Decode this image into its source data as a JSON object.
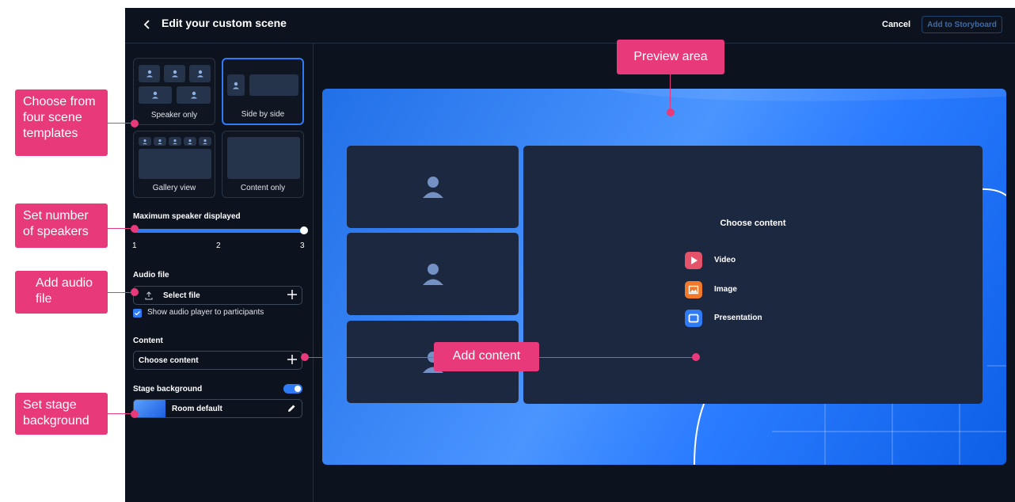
{
  "header": {
    "title": "Edit your custom scene",
    "cancel_label": "Cancel",
    "add_label": "Add to Storyboard"
  },
  "templates": [
    {
      "label": "Speaker only",
      "selected": false
    },
    {
      "label": "Side by side",
      "selected": true
    },
    {
      "label": "Gallery view",
      "selected": false
    },
    {
      "label": "Content only",
      "selected": false
    }
  ],
  "speakers": {
    "label": "Maximum speaker displayed",
    "ticks": [
      "1",
      "2",
      "3"
    ],
    "value": 3
  },
  "audio": {
    "label": "Audio file",
    "select_label": "Select file",
    "show_player_label": "Show audio player to participants",
    "show_player_checked": true
  },
  "content": {
    "label": "Content",
    "select_label": "Choose content"
  },
  "background": {
    "label": "Stage background",
    "enabled": true,
    "value": "Room default"
  },
  "preview": {
    "content_title": "Choose content",
    "options": [
      {
        "label": "Video",
        "color": "#e5536b",
        "icon": "play-icon"
      },
      {
        "label": "Image",
        "color": "#f07a2a",
        "icon": "image-icon"
      },
      {
        "label": "Presentation",
        "color": "#2f7bf5",
        "icon": "presentation-icon"
      }
    ]
  },
  "callouts": {
    "templates": "Choose from four scene templates",
    "speakers": "Set number of speakers",
    "audio": "Add audio file",
    "background": "Set stage background",
    "preview": "Preview area",
    "content": "Add content"
  },
  "colors": {
    "accent": "#2f7bf5",
    "annotation": "#e8397a",
    "app_background": "#0d131e"
  }
}
